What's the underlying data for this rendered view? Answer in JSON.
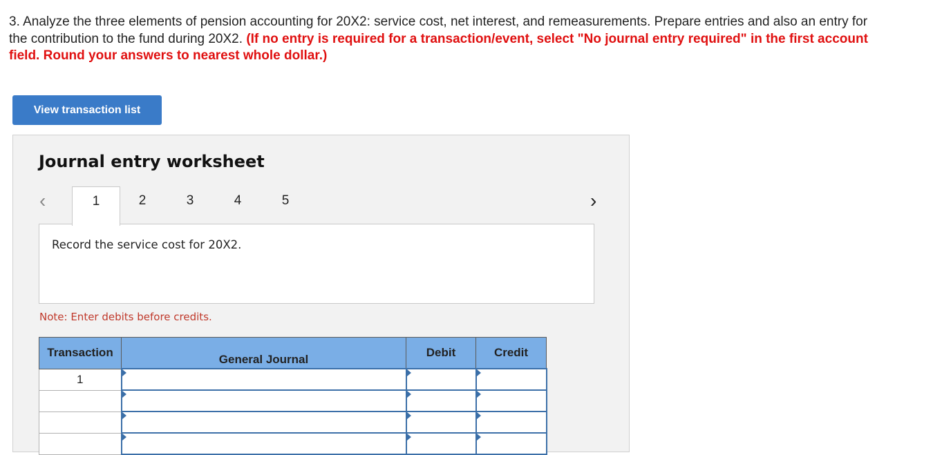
{
  "question": {
    "text": "3. Analyze the three elements of pension accounting for 20X2: service cost, net interest, and remeasurements. Prepare entries and also an entry for the contribution to the fund during 20X2.",
    "instruction": "(If no entry is required for a transaction/event, select \"No journal entry required\" in the first account field. Round your answers to nearest whole dollar.)"
  },
  "view_button_label": "View transaction list",
  "worksheet": {
    "title": "Journal entry worksheet",
    "tabs": [
      "1",
      "2",
      "3",
      "4",
      "5"
    ],
    "active_tab": "1",
    "description": "Record the service cost for 20X2.",
    "note": "Note: Enter debits before credits.",
    "table": {
      "headers": [
        "Transaction",
        "General Journal",
        "Debit",
        "Credit"
      ],
      "rows": [
        {
          "transaction": "1",
          "account": "",
          "debit": "",
          "credit": ""
        },
        {
          "transaction": "",
          "account": "",
          "debit": "",
          "credit": ""
        },
        {
          "transaction": "",
          "account": "",
          "debit": "",
          "credit": ""
        },
        {
          "transaction": "",
          "account": "",
          "debit": "",
          "credit": ""
        }
      ]
    }
  },
  "icons": {
    "prev": "chevron-left-icon",
    "next": "chevron-right-icon"
  },
  "colors": {
    "instruction": "#e01010",
    "button": "#3a7bc8",
    "table_header": "#7aaee6",
    "note": "#c0392b"
  }
}
